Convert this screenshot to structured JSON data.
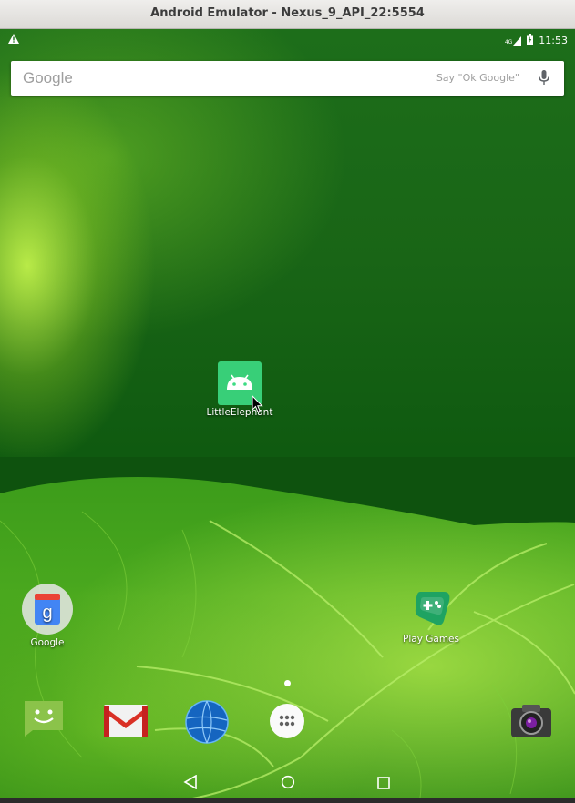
{
  "window": {
    "title": "Android Emulator - Nexus_9_API_22:5554"
  },
  "status_bar": {
    "warning_icon": "warning-icon",
    "network": "4G",
    "time": "11:53"
  },
  "search": {
    "logo": "Google",
    "hint": "Say \"Ok Google\"",
    "mic_icon": "mic-icon"
  },
  "desktop_apps": {
    "little_elephant": "LittleElephant",
    "google_folder": "Google",
    "play_games": "Play Games"
  },
  "dock": {
    "items": [
      "messaging-icon",
      "gmail-icon",
      "browser-icon",
      "app-drawer-icon",
      "camera-icon"
    ]
  },
  "nav_bar": {
    "back": "back-icon",
    "home": "home-icon",
    "recents": "recents-icon"
  },
  "colors": {
    "accent_green": "#3ddc84",
    "wallpaper_green": "#1d6e1a"
  }
}
